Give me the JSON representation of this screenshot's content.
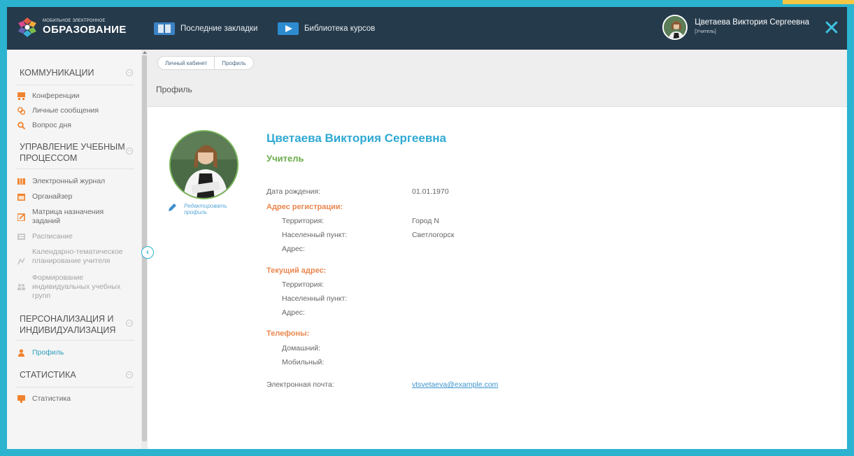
{
  "header": {
    "logo_top": "МОБИЛЬНОЕ ЭЛЕКТРОННОЕ",
    "logo_main": "ОБРАЗОВАНИЕ",
    "nav": [
      {
        "label": "Последние закладки",
        "icon": "bookmarks-book-icon"
      },
      {
        "label": "Библиотека курсов",
        "icon": "course-library-play-icon"
      }
    ],
    "user_name": "Цветаева Виктория Сергеевна",
    "user_role": "[Учитель]",
    "close_glyph": "✕"
  },
  "sidebar": {
    "sections": [
      {
        "title": "КОММУНИКАЦИИ",
        "toggle": "–",
        "items": [
          {
            "label": "Конференции",
            "icon": "conference-icon"
          },
          {
            "label": "Личные сообщения",
            "icon": "messages-icon"
          },
          {
            "label": "Вопрос дня",
            "icon": "search-question-icon"
          }
        ]
      },
      {
        "title": "УПРАВЛЕНИЕ УЧЕБНЫМ ПРОЦЕССОМ",
        "toggle": "–",
        "items": [
          {
            "label": "Электронный журнал",
            "icon": "journal-icon"
          },
          {
            "label": "Органайзер",
            "icon": "calendar-icon"
          },
          {
            "label": "Матрица назначения заданий",
            "icon": "assignment-icon"
          },
          {
            "label": "Расписание",
            "icon": "schedule-icon"
          },
          {
            "label": "Календарно-тематическое планирование учителя",
            "icon": "planning-icon"
          },
          {
            "label": "Формирование индивидуальных учебных групп",
            "icon": "groups-icon"
          }
        ]
      },
      {
        "title": "ПЕРСОНАЛИЗАЦИЯ И ИНДИВИДУАЛИЗАЦИЯ",
        "toggle": "–",
        "items": [
          {
            "label": "Профиль",
            "icon": "profile-person-icon"
          }
        ]
      },
      {
        "title": "СТАТИСТИКА",
        "toggle": "–",
        "items": [
          {
            "label": "Статистика",
            "icon": "statistics-icon"
          }
        ]
      }
    ],
    "collapse_glyph": "‹"
  },
  "breadcrumb": [
    "Личный кабинет",
    "Профиль"
  ],
  "page_title": "Профиль",
  "profile": {
    "name": "Цветаева Виктория Сергеевна",
    "role": "Учитель",
    "edit_label": "Редактировать профиль",
    "birth_label": "Дата рождения:",
    "birth_value": "01.01.1970",
    "reg_address_title": "Адрес регистрации:",
    "territory_label": "Территория:",
    "territory_value": "Город N",
    "settlement_label": "Населенный пункт:",
    "settlement_value": "Светлогорск",
    "address_label": "Адрес:",
    "current_address_title": "Текущий адрес:",
    "cur_territory_label": "Территория:",
    "cur_settlement_label": "Населенный пункт:",
    "cur_address_label": "Адрес:",
    "phones_title": "Телефоны:",
    "home_label": "Домашний:",
    "mobile_label": "Мобильный:",
    "email_label": "Электронная почта:",
    "email_value": "vtsvetaeva@example.com"
  },
  "colors": {
    "header_bg": "#253a4b",
    "frame": "#2bb3cf",
    "accent_blue": "#2fa9d3",
    "accent_green": "#6bab4c",
    "accent_orange": "#e9874f"
  }
}
